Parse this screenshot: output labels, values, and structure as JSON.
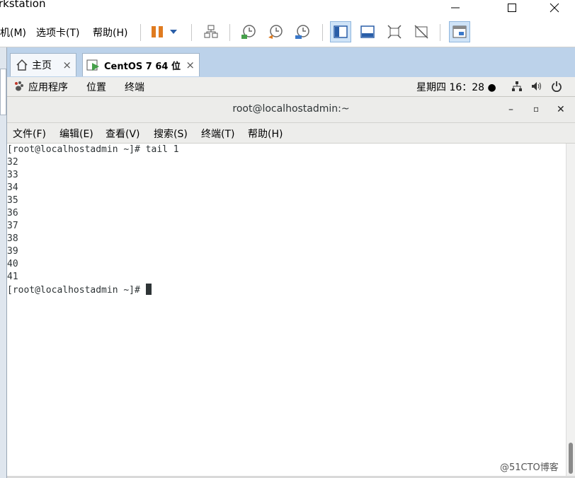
{
  "window": {
    "title": "rkstation"
  },
  "vm_menu": [
    {
      "label": "机(M)"
    },
    {
      "label": "选项卡(T)"
    },
    {
      "label": "帮助(H)"
    }
  ],
  "tabs": [
    {
      "label": "主页",
      "close": "×"
    },
    {
      "label": "CentOS 7 64 位",
      "close": "×"
    }
  ],
  "gnome_bar": {
    "apps": "应用程序",
    "places": "位置",
    "terminal": "终端",
    "clock": "星期四 16：28 ●"
  },
  "terminal": {
    "title": "root@localhostadmin:~",
    "minimize": "–",
    "maximize": "▫",
    "close": "✕",
    "menu": [
      "文件(F)",
      "编辑(E)",
      "查看(V)",
      "搜索(S)",
      "终端(T)",
      "帮助(H)"
    ],
    "lines": [
      "[root@localhostadmin ~]# tail 1",
      "32",
      "33",
      "34",
      "35",
      "36",
      "37",
      "38",
      "39",
      "40",
      "41",
      "[root@localhostadmin ~]# "
    ]
  },
  "watermark": "@51CTO博客",
  "colors": {
    "accent": "#3a78c9",
    "tab_strip": "#bcd2ea",
    "pause_orange": "#e07b1f"
  }
}
